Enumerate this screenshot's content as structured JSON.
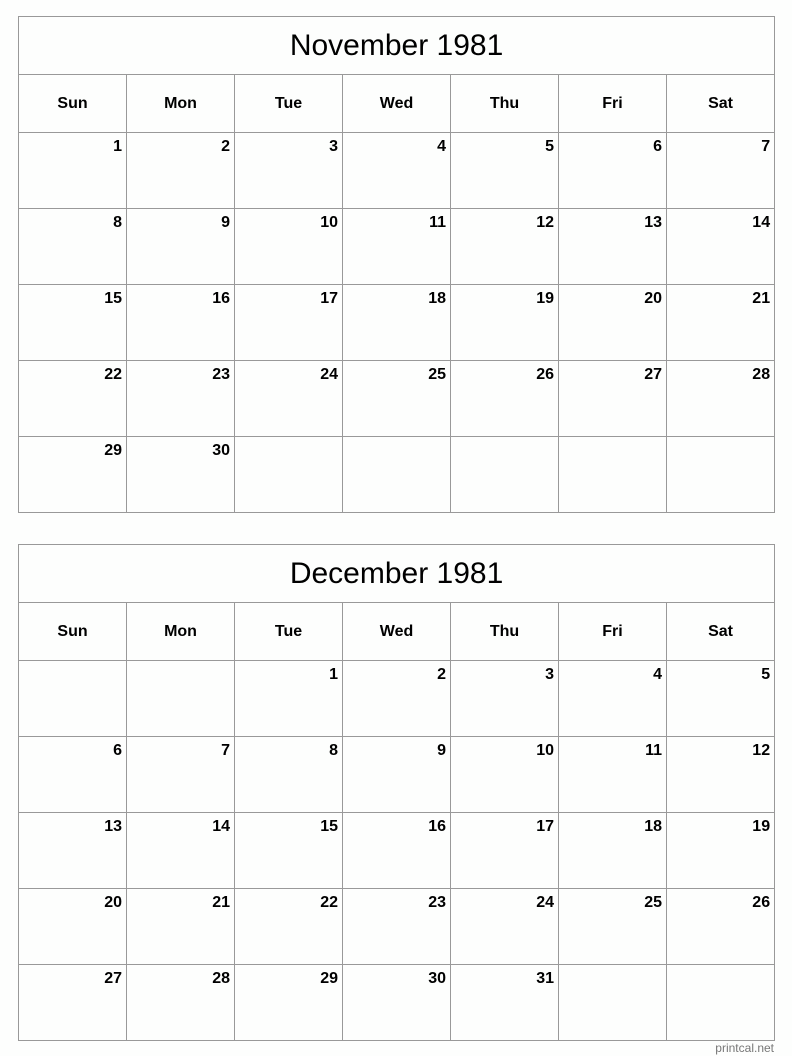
{
  "calendars": [
    {
      "title": "November 1981",
      "weekdays": [
        "Sun",
        "Mon",
        "Tue",
        "Wed",
        "Thu",
        "Fri",
        "Sat"
      ],
      "weeks": [
        [
          "1",
          "2",
          "3",
          "4",
          "5",
          "6",
          "7"
        ],
        [
          "8",
          "9",
          "10",
          "11",
          "12",
          "13",
          "14"
        ],
        [
          "15",
          "16",
          "17",
          "18",
          "19",
          "20",
          "21"
        ],
        [
          "22",
          "23",
          "24",
          "25",
          "26",
          "27",
          "28"
        ],
        [
          "29",
          "30",
          "",
          "",
          "",
          "",
          ""
        ]
      ]
    },
    {
      "title": "December 1981",
      "weekdays": [
        "Sun",
        "Mon",
        "Tue",
        "Wed",
        "Thu",
        "Fri",
        "Sat"
      ],
      "weeks": [
        [
          "",
          "",
          "1",
          "2",
          "3",
          "4",
          "5"
        ],
        [
          "6",
          "7",
          "8",
          "9",
          "10",
          "11",
          "12"
        ],
        [
          "13",
          "14",
          "15",
          "16",
          "17",
          "18",
          "19"
        ],
        [
          "20",
          "21",
          "22",
          "23",
          "24",
          "25",
          "26"
        ],
        [
          "27",
          "28",
          "29",
          "30",
          "31",
          "",
          ""
        ]
      ]
    }
  ],
  "footer": {
    "credit": "printcal.net"
  }
}
